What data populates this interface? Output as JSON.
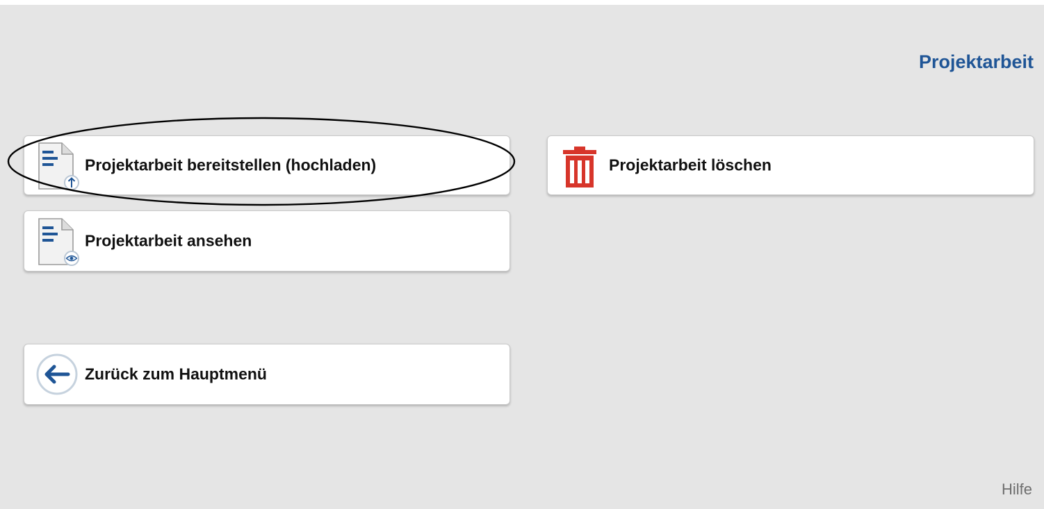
{
  "header": {
    "title": "Projektarbeit"
  },
  "menu": {
    "upload": {
      "label": "Projektarbeit bereitstellen (hochladen)",
      "icon": "document-upload-icon"
    },
    "view": {
      "label": "Projektarbeit ansehen",
      "icon": "document-view-icon"
    },
    "back": {
      "label": "Zurück zum Hauptmenü",
      "icon": "arrow-left-icon"
    },
    "delete": {
      "label": "Projektarbeit löschen",
      "icon": "trash-icon"
    }
  },
  "footer": {
    "help_label": "Hilfe"
  },
  "colors": {
    "background": "#e5e5e5",
    "title": "#1f5596",
    "icon_blue": "#1f5596",
    "trash_red": "#d7352a"
  }
}
